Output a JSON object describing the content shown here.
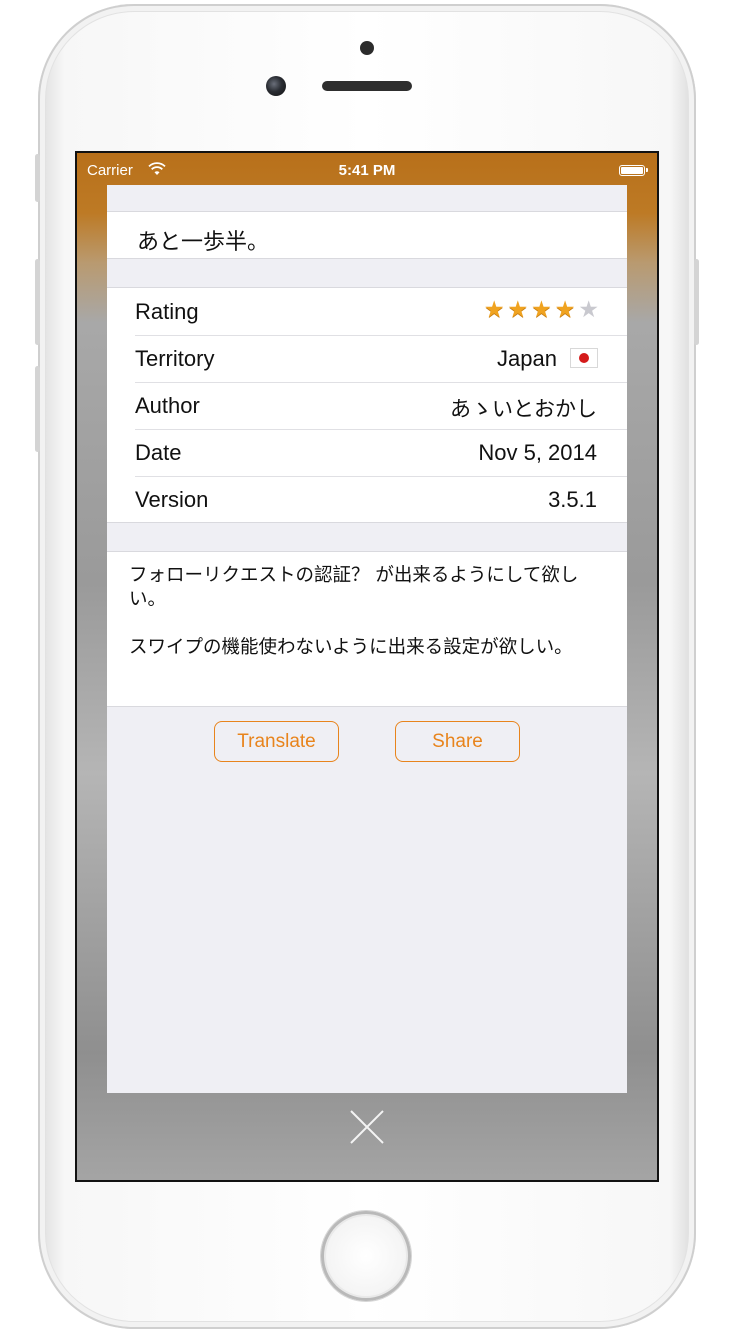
{
  "status_bar": {
    "carrier": "Carrier",
    "time": "5:41 PM"
  },
  "review": {
    "title": "あと一歩半。",
    "body_paragraphs": [
      "フォローリクエストの認証？ が出来るようにして欲しい。",
      "スワイプの機能使わないように出来る設定が欲しい。"
    ]
  },
  "details": {
    "rating": {
      "label": "Rating",
      "value": 4,
      "max": 5
    },
    "territory": {
      "label": "Territory",
      "value": "Japan",
      "flag_icon": "japan-flag-icon"
    },
    "author": {
      "label": "Author",
      "value": "あゝいとおかし"
    },
    "date": {
      "label": "Date",
      "value": "Nov 5, 2014"
    },
    "version": {
      "label": "Version",
      "value": "3.5.1"
    }
  },
  "actions": {
    "translate_label": "Translate",
    "share_label": "Share"
  },
  "colors": {
    "accent": "#e8841c",
    "star_on": "#f0a320",
    "star_off": "#c9c9cf",
    "status_bar": "#b8701a"
  },
  "icons": {
    "close": "close-icon",
    "wifi": "wifi-icon",
    "battery": "battery-icon",
    "star": "star-icon"
  }
}
